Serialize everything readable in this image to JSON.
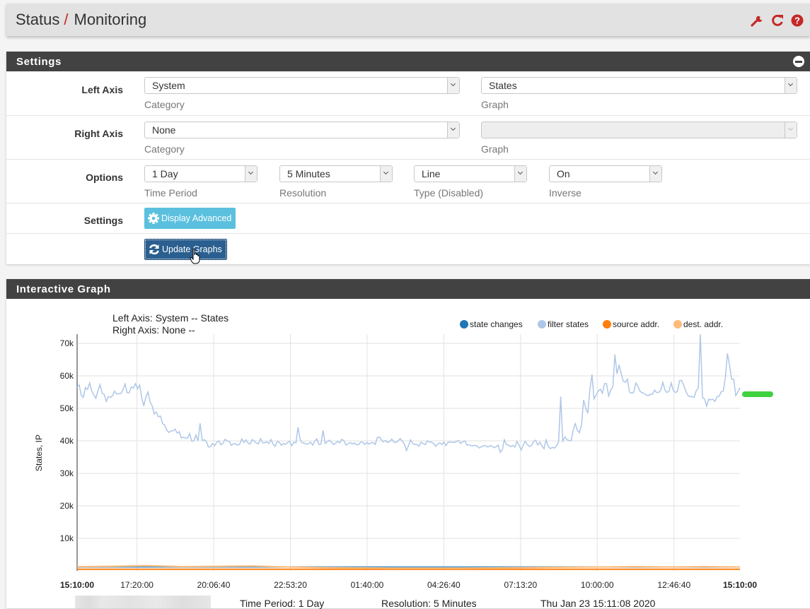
{
  "header": {
    "breadcrumb": [
      "Status",
      "Monitoring"
    ],
    "separator": "/",
    "icons": [
      "wrench-icon",
      "refresh-icon",
      "help-icon"
    ],
    "icon_color": "#c62828"
  },
  "settings_panel": {
    "title": "Settings",
    "rows": {
      "left_axis": {
        "label": "Left Axis",
        "category_value": "System",
        "category_help": "Category",
        "graph_value": "States",
        "graph_help": "Graph"
      },
      "right_axis": {
        "label": "Right Axis",
        "category_value": "None",
        "category_help": "Category",
        "graph_value": "",
        "graph_help": "Graph"
      },
      "options": {
        "label": "Options",
        "time_period_value": "1 Day",
        "time_period_help": "Time Period",
        "resolution_value": "5 Minutes",
        "resolution_help": "Resolution",
        "type_value": "Line",
        "type_help": "Type (Disabled)",
        "inverse_value": "On",
        "inverse_help": "Inverse"
      },
      "settings": {
        "label": "Settings",
        "display_advanced_label": "Display Advanced"
      },
      "update": {
        "update_graphs_label": "Update Graphs"
      }
    }
  },
  "graph_panel": {
    "title": "Interactive Graph",
    "footer": {
      "time_period": "Time Period: 1 Day",
      "resolution": "Resolution: 5 Minutes",
      "timestamp": "Thu Jan 23 15:11:08 2020"
    }
  },
  "chart_data": {
    "type": "line",
    "title": "Left Axis: System -- States",
    "subtitle": "Right Axis: None --",
    "ylabel": "States, IP",
    "xlabel": "",
    "ylim": [
      0,
      72000
    ],
    "grid": true,
    "legend_position": "top-right",
    "y_ticks": [
      "10k",
      "20k",
      "30k",
      "40k",
      "50k",
      "60k",
      "70k"
    ],
    "y_tick_values": [
      10000,
      20000,
      30000,
      40000,
      50000,
      60000,
      70000
    ],
    "x_ticks": [
      "15:10:00",
      "17:20:00",
      "20:06:40",
      "22:53:20",
      "01:40:00",
      "04:26:40",
      "07:13:20",
      "10:00:00",
      "12:46:40",
      "15:10:00"
    ],
    "x_tick_fractions": [
      0,
      0.0903,
      0.206,
      0.3218,
      0.4375,
      0.5532,
      0.669,
      0.7847,
      0.9005,
      1
    ],
    "x_tick_bold": [
      true,
      false,
      false,
      false,
      false,
      false,
      false,
      false,
      false,
      true
    ],
    "series": [
      {
        "name": "state changes",
        "color": "#1f77b4",
        "line_color": "#5b9bc7",
        "values_k": [
          1.2,
          1.2,
          1.2,
          1.2,
          1.2,
          1.2,
          1.2,
          1.2,
          1.2,
          1.2,
          1.2,
          1.2,
          1.2,
          1.2,
          1.2,
          1.2,
          1.2,
          1.2,
          1.2,
          1.2
        ]
      },
      {
        "name": "filter states",
        "color": "#aec7e8",
        "line_color": "#aec7e8",
        "values_k": [
          56.5,
          57.2,
          54.0,
          53.4,
          56.4,
          55.8,
          57.8,
          55.4,
          54.2,
          53.1,
          55.4,
          57.3,
          54.7,
          54.3,
          52.1,
          53.6,
          53.4,
          53.9,
          55.3,
          54.4,
          54.5,
          54.6,
          55.7,
          57.5,
          54.8,
          54.8,
          56.6,
          56.2,
          57.6,
          56.0,
          57.2,
          53.3,
          50.7,
          53.5,
          55.0,
          52.0,
          50.8,
          48.3,
          48.9,
          47.4,
          47.6,
          45.3,
          44.9,
          43.3,
          42.6,
          43.0,
          43.1,
          43.6,
          42.4,
          42.8,
          40.9,
          41.1,
          40.9,
          40.9,
          42.2,
          39.9,
          40.0,
          41.8,
          40.0,
          45.4,
          40.2,
          40.3,
          39.8,
          38.1,
          38.2,
          39.2,
          38.5,
          39.6,
          40.0,
          38.8,
          39.3,
          40.5,
          39.9,
          39.9,
          38.6,
          39.1,
          39.1,
          38.6,
          39.0,
          40.6,
          39.5,
          40.3,
          39.3,
          39.0,
          40.4,
          39.9,
          39.3,
          39.1,
          40.7,
          39.4,
          39.4,
          39.7,
          39.2,
          40.4,
          39.0,
          38.3,
          39.8,
          39.6,
          38.6,
          39.2,
          38.9,
          39.5,
          39.8,
          38.5,
          39.6,
          39.4,
          44.2,
          40.4,
          39.4,
          39.3,
          39.0,
          39.1,
          39.6,
          38.7,
          39.9,
          40.6,
          38.9,
          39.0,
          43.2,
          39.2,
          39.7,
          40.2,
          39.6,
          38.9,
          39.3,
          39.8,
          39.4,
          40.5,
          40.0,
          38.7,
          39.1,
          39.5,
          39.0,
          39.4,
          38.8,
          38.8,
          39.6,
          39.6,
          38.9,
          39.5,
          39.0,
          39.4,
          39.5,
          38.9,
          41.0,
          41.2,
          40.3,
          39.7,
          40.1,
          39.5,
          39.8,
          40.5,
          39.6,
          39.5,
          40.0,
          40.7,
          39.9,
          39.0,
          37.0,
          38.6,
          40.3,
          39.2,
          38.9,
          38.9,
          38.3,
          39.6,
          39.2,
          38.8,
          40.0,
          39.6,
          39.6,
          39.2,
          38.3,
          39.0,
          39.4,
          38.9,
          39.6,
          38.5,
          39.6,
          39.6,
          39.6,
          39.5,
          39.8,
          40.1,
          39.2,
          39.7,
          40.0,
          38.7,
          38.8,
          38.5,
          38.5,
          38.6,
          38.3,
          37.8,
          38.2,
          38.5,
          38.5,
          38.1,
          38.5,
          38.4,
          37.9,
          38.2,
          38.7,
          36.5,
          37.3,
          40.3,
          38.8,
          38.7,
          38.2,
          38.6,
          38.1,
          39.8,
          38.7,
          37.2,
          38.7,
          39.9,
          38.8,
          38.3,
          38.5,
          39.8,
          40.2,
          38.7,
          39.6,
          38.4,
          37.6,
          40.3,
          38.3,
          37.6,
          38.0,
          37.8,
          38.5,
          39.8,
          53.6,
          39.9,
          41.2,
          40.4,
          40.1,
          40.0,
          43.4,
          45.3,
          43.2,
          42.5,
          45.1,
          52.6,
          50.0,
          48.5,
          55.7,
          60.4,
          52.9,
          54.1,
          55.3,
          55.9,
          54.6,
          57.6,
          57.6,
          53.8,
          55.6,
          56.6,
          66.6,
          60.6,
          63.4,
          60.8,
          58.4,
          58.0,
          59.0,
          55.0,
          54.7,
          54.9,
          57.8,
          56.9,
          55.3,
          54.8,
          54.6,
          54.1,
          53.9,
          54.3,
          54.3,
          55.6,
          54.9,
          54.9,
          55.6,
          58.0,
          55.6,
          54.9,
          55.3,
          57.8,
          55.6,
          54.9,
          55.2,
          58.5,
          58.6,
          57.2,
          55.3,
          54.0,
          53.6,
          53.6,
          53.4,
          55.4,
          56.3,
          72.8,
          53.3,
          52.9,
          50.7,
          52.8,
          52.6,
          52.8,
          52.1,
          53.6,
          53.7,
          55.1,
          55.3,
          59.6,
          66.9,
          63.2,
          59.0,
          59.0,
          53.9,
          55.1,
          56.3
        ]
      },
      {
        "name": "source addr.",
        "color": "#ff7f0e",
        "line_color": "#ff7f0e",
        "values_k": [
          0.5,
          0.5,
          0.5,
          0.5,
          0.5,
          0.5,
          0.5,
          0.5,
          0.5,
          0.5,
          0.5,
          0.5,
          0.5,
          0.5,
          0.5,
          0.5,
          0.5,
          0.5,
          0.5,
          0.5
        ]
      },
      {
        "name": "dest. addr.",
        "color": "#ffbb78",
        "line_color": "#ffbb78",
        "values_k": [
          1.3,
          1.4,
          1.6,
          1.3,
          1.4,
          1.5,
          1.2,
          1.0,
          0.9,
          0.8,
          0.8,
          0.8,
          0.9,
          1.0,
          1.1,
          1.2,
          1.3,
          1.2,
          1.3,
          1.2
        ]
      }
    ]
  }
}
